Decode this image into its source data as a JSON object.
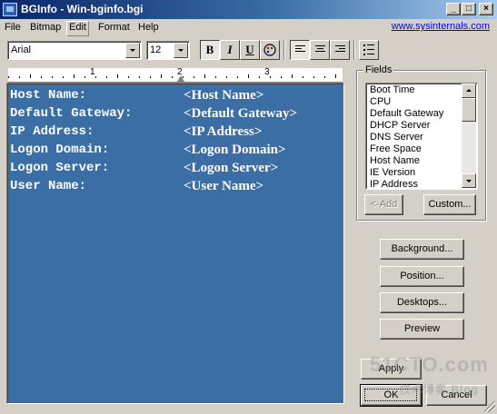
{
  "window": {
    "title": "BGInfo - Win-bginfo.bgi"
  },
  "menu": {
    "items": [
      "File",
      "Bitmap",
      "Edit",
      "Format",
      "Help"
    ],
    "link": "www.sysinternals.com"
  },
  "toolbar": {
    "font": "Arial",
    "size": "12",
    "bold": "B",
    "italic": "I",
    "underline": "U"
  },
  "ruler": {
    "numbers": [
      "1",
      "2",
      "3"
    ]
  },
  "editor": {
    "background": "#3a6ea5",
    "lines": [
      {
        "label": "Host Name:",
        "value": "<Host Name>"
      },
      {
        "label": "Default Gateway:",
        "value": "<Default Gateway>"
      },
      {
        "label": "IP Address:",
        "value": "<IP Address>"
      },
      {
        "label": "Logon Domain:",
        "value": "<Logon Domain>"
      },
      {
        "label": "Logon Server:",
        "value": "<Logon Server>"
      },
      {
        "label": "User Name:",
        "value": "<User Name>"
      }
    ]
  },
  "fields": {
    "label": "Fields",
    "items": [
      "Boot Time",
      "CPU",
      "Default Gateway",
      "DHCP Server",
      "DNS Server",
      "Free Space",
      "Host Name",
      "IE Version",
      "IP Address"
    ],
    "add_button": "<-Add",
    "custom_button": "Custom..."
  },
  "buttons": {
    "background": "Background...",
    "position": "Position...",
    "desktops": "Desktops...",
    "preview": "Preview",
    "apply": "Apply",
    "ok": "OK",
    "cancel": "Cancel"
  },
  "watermark": {
    "text": "51CTO.com",
    "subtext": "技术博客  Blog"
  }
}
